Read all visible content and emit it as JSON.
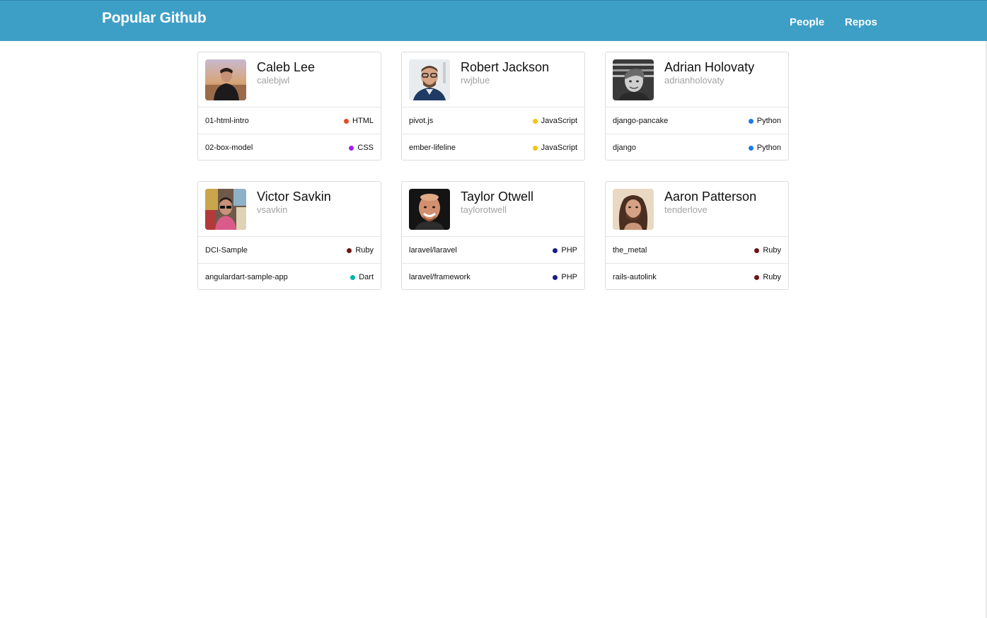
{
  "header": {
    "brand": "Popular Github",
    "nav": {
      "people": "People",
      "repos": "Repos"
    }
  },
  "people": [
    {
      "name": "Caleb Lee",
      "login": "calebjwl",
      "avatar_icon": "person-photo",
      "repos": [
        {
          "name": "01-html-intro",
          "language": "HTML",
          "color": "#e34c26"
        },
        {
          "name": "02-box-model",
          "language": "CSS",
          "color": "#a020f0"
        }
      ]
    },
    {
      "name": "Robert Jackson",
      "login": "rwjblue",
      "avatar_icon": "person-photo",
      "repos": [
        {
          "name": "pivot.js",
          "language": "JavaScript",
          "color": "#f1c40f"
        },
        {
          "name": "ember-lifeline",
          "language": "JavaScript",
          "color": "#f1c40f"
        }
      ]
    },
    {
      "name": "Adrian Holovaty",
      "login": "adrianholovaty",
      "avatar_icon": "person-photo",
      "repos": [
        {
          "name": "django-pancake",
          "language": "Python",
          "color": "#1e7ae6"
        },
        {
          "name": "django",
          "language": "Python",
          "color": "#1e7ae6"
        }
      ]
    },
    {
      "name": "Victor Savkin",
      "login": "vsavkin",
      "avatar_icon": "person-photo",
      "repos": [
        {
          "name": "DCI-Sample",
          "language": "Ruby",
          "color": "#701516"
        },
        {
          "name": "angulardart-sample-app",
          "language": "Dart",
          "color": "#00b4ab"
        }
      ]
    },
    {
      "name": "Taylor Otwell",
      "login": "taylorotwell",
      "avatar_icon": "person-photo",
      "repos": [
        {
          "name": "laravel/laravel",
          "language": "PHP",
          "color": "#1a1a8c"
        },
        {
          "name": "laravel/framework",
          "language": "PHP",
          "color": "#1a1a8c"
        }
      ]
    },
    {
      "name": "Aaron Patterson",
      "login": "tenderlove",
      "avatar_icon": "person-photo",
      "repos": [
        {
          "name": "the_metal",
          "language": "Ruby",
          "color": "#701516"
        },
        {
          "name": "rails-autolink",
          "language": "Ruby",
          "color": "#701516"
        }
      ]
    }
  ]
}
